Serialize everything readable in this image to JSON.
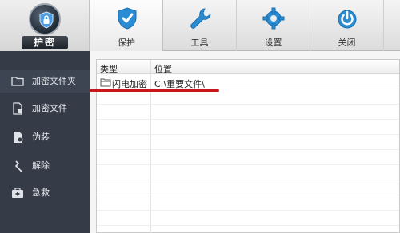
{
  "app": {
    "logo_label": "护密"
  },
  "tabs": [
    {
      "label": "保护",
      "icon": "shield-check-icon",
      "active": true
    },
    {
      "label": "工具",
      "icon": "wrench-icon",
      "active": false
    },
    {
      "label": "设置",
      "icon": "gear-icon",
      "active": false
    },
    {
      "label": "关闭",
      "icon": "power-icon",
      "active": false
    }
  ],
  "sidebar": {
    "items": [
      {
        "label": "加密文件夹",
        "icon": "folder-icon"
      },
      {
        "label": "加密文件",
        "icon": "file-lock-icon"
      },
      {
        "label": "伪装",
        "icon": "disguise-icon"
      },
      {
        "label": "解除",
        "icon": "unlock-icon"
      },
      {
        "label": "急救",
        "icon": "first-aid-icon"
      }
    ]
  },
  "table": {
    "columns": [
      "类型",
      "位置"
    ],
    "rows": [
      {
        "type": "闪电加密",
        "path": "C:\\重要文件\\"
      }
    ]
  },
  "colors": {
    "sidebar_bg": "#353c47",
    "accent_underline": "#c8161d",
    "tab_icon_blue": "#2a8dd4"
  }
}
